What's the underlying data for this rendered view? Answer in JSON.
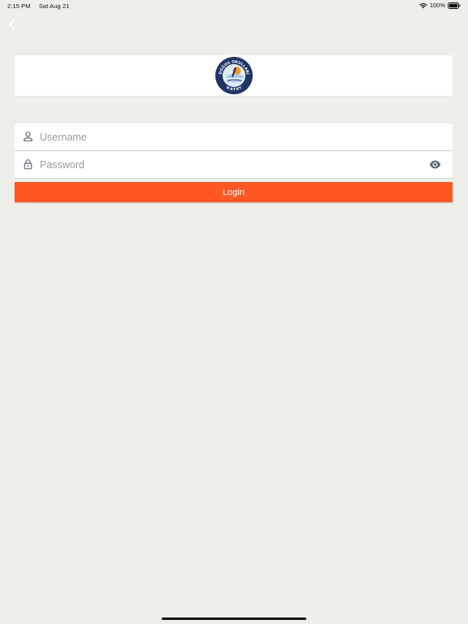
{
  "status_bar": {
    "time": "2:15 PM",
    "date": "Sat Aug 21",
    "battery": "100%"
  },
  "icons": {
    "back": "chevron-left-icon",
    "user": "person-icon",
    "password": "lock-icon",
    "toggle_password": "eye-icon",
    "wifi": "wifi-icon",
    "battery": "battery-icon"
  },
  "logo": {
    "top_text": "DOĞUŞ OKULLARI",
    "bottom_text": "HATAY"
  },
  "form": {
    "username_placeholder": "Username",
    "username_value": "",
    "password_placeholder": "Password",
    "password_value": "",
    "login_label": "Login"
  },
  "colors": {
    "background": "#efefea",
    "accent": "#ff5722",
    "icon": "#5f6b78",
    "logo_navy": "#1f3566"
  }
}
